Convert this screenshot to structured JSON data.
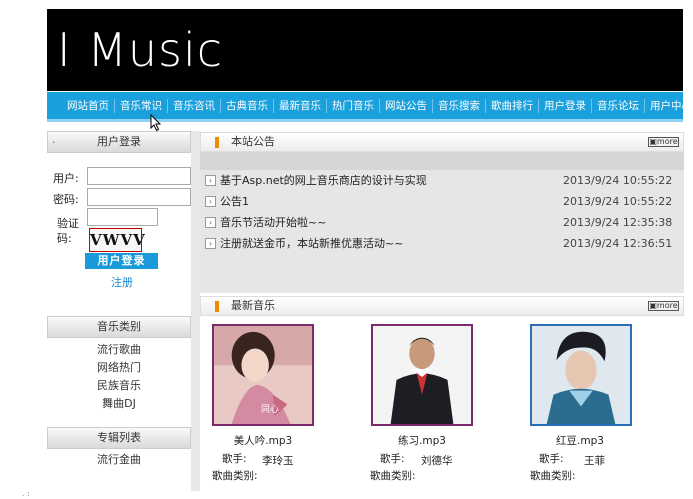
{
  "header": {
    "logo": "I Music"
  },
  "nav": {
    "items": [
      "网站首页",
      "音乐常识",
      "音乐咨讯",
      "古典音乐",
      "最新音乐",
      "热门音乐",
      "网站公告",
      "音乐搜索",
      "歌曲排行",
      "用户登录",
      "音乐论坛",
      "用户中心"
    ]
  },
  "login": {
    "title": "用户登录",
    "user_label": "用户:",
    "password_label": "密码:",
    "captcha_label_1": "验证",
    "captcha_label_2": "码:",
    "captcha_text": "VWVV",
    "login_button": "用户登录",
    "register_link": "注册"
  },
  "categories": {
    "title": "音乐类别",
    "items": [
      "流行歌曲",
      "网络热门",
      "民族音乐",
      "舞曲DJ"
    ]
  },
  "albums_box": {
    "title": "专辑列表",
    "items": [
      "流行金曲"
    ]
  },
  "notice": {
    "title": "本站公告",
    "more": "more",
    "rows": [
      {
        "text": "基于Asp.net的网上音乐商店的设计与实现",
        "time": "2013/9/24 10:55:22"
      },
      {
        "text": "公告1",
        "time": "2013/9/24 10:55:22"
      },
      {
        "text": "音乐节活动开始啦~~",
        "time": "2013/9/24 12:35:38"
      },
      {
        "text": "注册就送金币，本站新推优惠活动~~",
        "time": "2013/9/24 12:36:51"
      }
    ]
  },
  "latest": {
    "title": "最新音乐",
    "more": "more",
    "songs": [
      {
        "file": "美人吟.mp3",
        "singer_label": "歌手:",
        "singer": "李玲玉",
        "cat_label": "歌曲类别:"
      },
      {
        "file": "练习.mp3",
        "singer_label": "歌手:",
        "singer": "刘德华",
        "cat_label": "歌曲类别:"
      },
      {
        "file": "红豆.mp3",
        "singer_label": "歌手:",
        "singer": "王菲",
        "cat_label": "歌曲类别:"
      }
    ]
  },
  "colors": {
    "nav_blue": "#19a0dd",
    "banner_black": "#000000",
    "accent_orange": "#f08a00"
  }
}
